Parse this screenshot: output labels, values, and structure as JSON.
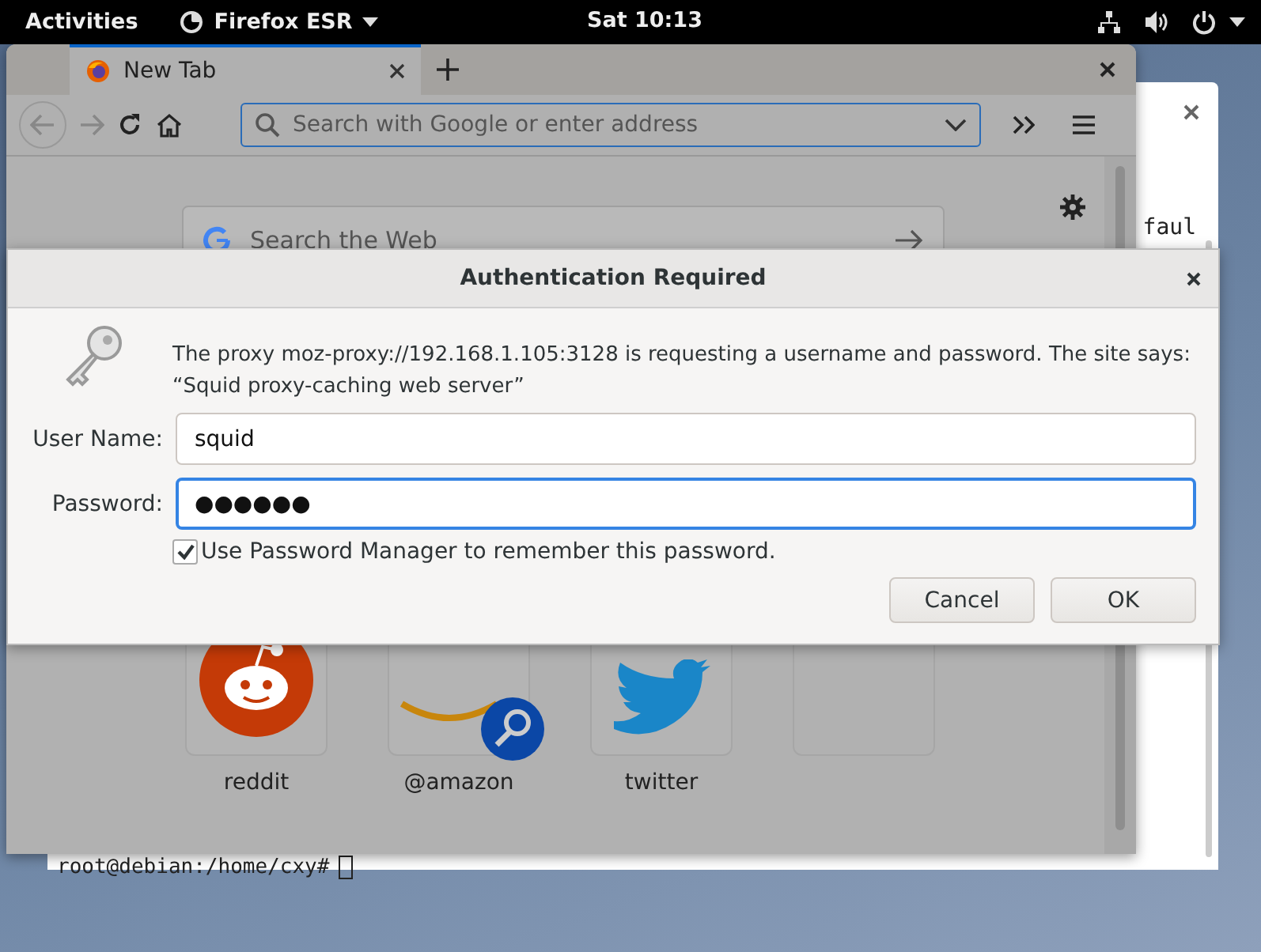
{
  "top_bar": {
    "activities": "Activities",
    "app_menu": "Firefox ESR",
    "clock": "Sat 10:13"
  },
  "terminal": {
    "visible_text": "faul",
    "prompt": "root@debian:/home/cxy#"
  },
  "browser": {
    "tabs": [
      {
        "label": "New Tab",
        "selected": true
      }
    ],
    "address_bar": {
      "placeholder": "Search with Google or enter address"
    },
    "web_search": {
      "placeholder": "Search the Web"
    },
    "top_sites": [
      {
        "label": "reddit",
        "kind": "reddit"
      },
      {
        "label": "@amazon",
        "kind": "amazon"
      },
      {
        "label": "twitter",
        "kind": "twitter"
      },
      {
        "kind": "empty"
      }
    ]
  },
  "dialog": {
    "title": "Authentication Required",
    "message": "The proxy moz-proxy://192.168.1.105:3128 is requesting a username and password. The site says: “Squid proxy-caching web server”",
    "fields": [
      {
        "label": "User Name:",
        "value": "squid",
        "focused": false
      },
      {
        "label": "Password:",
        "value": "●●●●●●",
        "focused": true
      }
    ],
    "remember": {
      "label": "Use Password Manager to remember this password.",
      "checked": true
    },
    "buttons": [
      "Cancel",
      "OK"
    ]
  }
}
